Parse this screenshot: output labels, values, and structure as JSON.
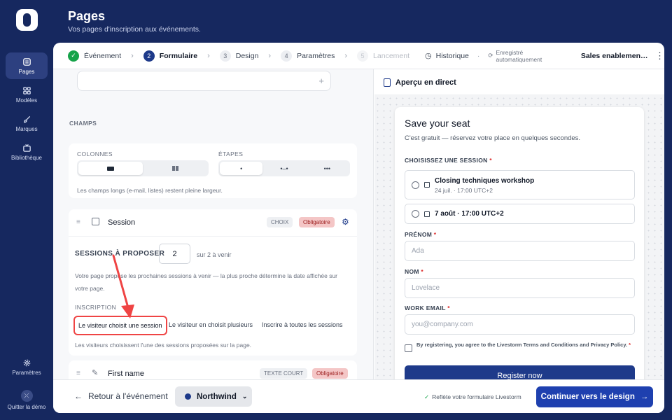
{
  "header": {
    "title": "Pages",
    "subtitle": "Vos pages d'inscription aux événements."
  },
  "sidebar": {
    "items": [
      {
        "label": "Pages",
        "icon": "pages-icon"
      },
      {
        "label": "Modèles",
        "icon": "grid-icon"
      },
      {
        "label": "Marques",
        "icon": "brush-icon"
      },
      {
        "label": "Bibliothèque",
        "icon": "tv-icon"
      }
    ],
    "settings": "Paramètres",
    "quit": "Quitter la démo"
  },
  "steps": [
    {
      "num": "",
      "label": "Événement",
      "state": "done"
    },
    {
      "num": "2",
      "label": "Formulaire",
      "state": "current"
    },
    {
      "num": "3",
      "label": "Design",
      "state": "todo"
    },
    {
      "num": "4",
      "label": "Paramètres",
      "state": "todo"
    },
    {
      "num": "5",
      "label": "Lancement",
      "state": "disabled"
    }
  ],
  "toolbar": {
    "history": "Historique",
    "autosave": "Enregistré automatiquement",
    "event_name": "Sales enablement live"
  },
  "fields": {
    "section_title": "CHAMPS",
    "columns_label": "COLONNES",
    "steps_label": "ÉTAPES",
    "layout_hint": "Les champs longs (e-mail, listes) restent pleine largeur.",
    "session": {
      "name": "Session",
      "type": "CHOIX",
      "required": "Obligatoire",
      "propose_label": "SESSIONS À PROPOSER",
      "propose_value": "2",
      "propose_suffix": "sur 2 à venir",
      "propose_help": "Votre page propose les prochaines sessions à venir — la plus proche détermine la date affichée sur votre page.",
      "inscription_label": "INSCRIPTION",
      "options": [
        "Le visiteur choisit une session",
        "Le visiteur en choisit plusieurs",
        "Inscrire à toutes les sessions"
      ],
      "selected": "Le visiteur choisit une session",
      "options_help": "Les visiteurs choisissent l'une des sessions proposées sur la page."
    },
    "firstname": {
      "name": "First name",
      "type": "TEXTE COURT",
      "required": "Obligatoire"
    }
  },
  "preview": {
    "title": "Aperçu en direct",
    "form_title": "Save your seat",
    "form_sub": "C'est gratuit — réservez votre place en quelques secondes.",
    "session_label": "CHOISISSEZ UNE SESSION",
    "sessions": [
      {
        "title": "Closing techniques workshop",
        "date": "24 juil. · 17:00 UTC+2"
      },
      {
        "title": "7 août · 17:00 UTC+2",
        "date": ""
      }
    ],
    "firstname_label": "PRÉNOM",
    "firstname_ph": "Ada",
    "lastname_label": "NOM",
    "lastname_ph": "Lovelace",
    "email_label": "WORK EMAIL",
    "email_ph": "you@company.com",
    "consent": "By registering, you agree to the Livestorm Terms and Conditions and Privacy Policy.",
    "required_mark": "*",
    "submit": "Register now"
  },
  "footer": {
    "back": "Retour à l'événement",
    "brand": "Northwind",
    "sync_note": "Reflète votre formulaire Livestorm",
    "continue": "Continuer vers le design"
  },
  "colors": {
    "navy": "#16285f",
    "primary": "#1e3a8a",
    "success": "#16a34a",
    "danger": "#dc2626",
    "required_badge": "#f4c6c6"
  }
}
